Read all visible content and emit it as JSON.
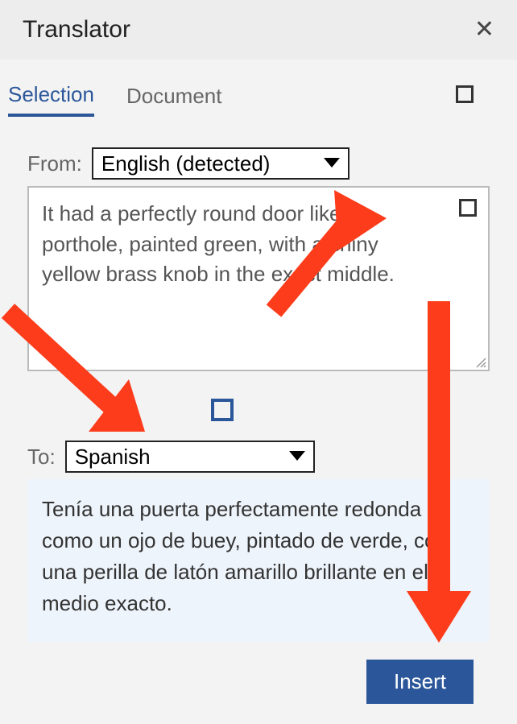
{
  "header": {
    "title": "Translator"
  },
  "tabs": {
    "selection": "Selection",
    "document": "Document"
  },
  "from": {
    "label": "From:",
    "value": "English (detected)"
  },
  "sourceText": "It had a perfectly round door like a porthole, painted green, with a shiny yellow brass knob in the exact middle.",
  "to": {
    "label": "To:",
    "value": "Spanish"
  },
  "targetText": "Tenía una puerta perfectamente redonda como un ojo de buey, pintado de verde, con una perilla de latón amarillo brillante en el medio exacto.",
  "buttons": {
    "insert": "Insert"
  },
  "colors": {
    "accent": "#2b579a",
    "annotation": "#fc3c1b"
  }
}
